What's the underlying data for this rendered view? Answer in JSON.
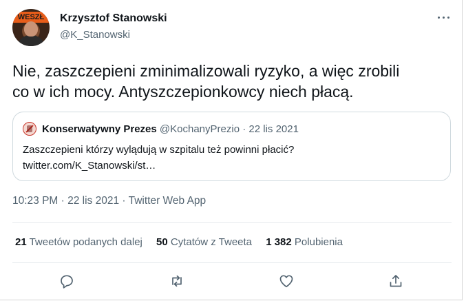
{
  "tweet": {
    "author_name": "Krzysztof Stanowski",
    "author_handle": "@K_Stanowski",
    "avatar_text": "WESZŁ",
    "more_icon": "more-dots-icon",
    "text_line1": "Nie, zaszczepieni zminimalizowali ryzyko, a więc zrobili",
    "text_line2": "co w ich mocy. Antyszczepionkowcy niech płacą."
  },
  "quote": {
    "author_name": "Konserwatywny Prezes",
    "author_handle": "@KochanyPrezio",
    "separator": " · ",
    "date": "22 lis 2021",
    "text_line1": "Zaszczepieni którzy wylądują w szpitalu też powinni płacić?",
    "text_line2": "twitter.com/K_Stanowski/st…"
  },
  "timestamp": "10:23 PM · 22 lis 2021 · Twitter Web App",
  "stats": [
    {
      "count": "21",
      "label": "Tweetów podanych dalej"
    },
    {
      "count": "50",
      "label": "Cytatów z Tweeta"
    },
    {
      "count": "1 382",
      "label": "Polubienia"
    }
  ],
  "actions": [
    {
      "name": "reply-icon"
    },
    {
      "name": "retweet-icon"
    },
    {
      "name": "like-icon"
    },
    {
      "name": "share-icon"
    }
  ],
  "colors": {
    "text_primary": "#0f1419",
    "text_secondary": "#536471",
    "border": "#cfd9de"
  }
}
